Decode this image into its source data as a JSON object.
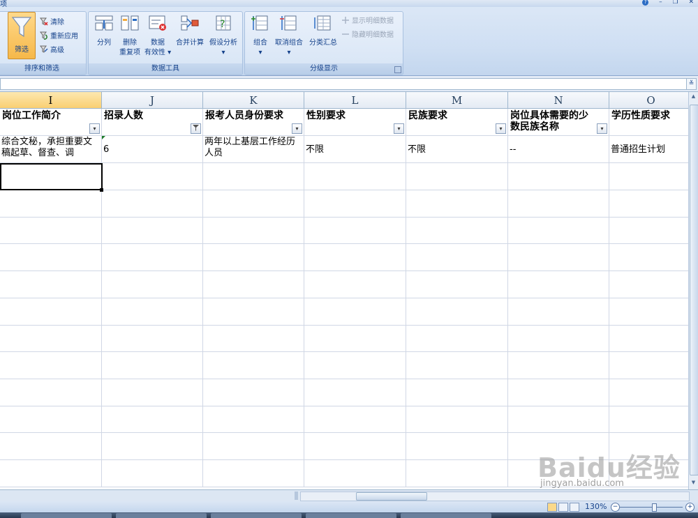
{
  "titlebar": {
    "tab_fragment": "项"
  },
  "ribbon": {
    "sort_filter": {
      "label": "排序和筛选",
      "filter": "筛选",
      "clear": "清除",
      "reapply": "重新应用",
      "advanced": "高级"
    },
    "data_tools": {
      "label": "数据工具",
      "text_to_columns": "分列",
      "remove_duplicates_1": "删除",
      "remove_duplicates_2": "重复项",
      "validation_1": "数据",
      "validation_2": "有效性",
      "consolidate": "合并计算",
      "whatif": "假设分析"
    },
    "outline": {
      "label": "分级显示",
      "group": "组合",
      "ungroup": "取消组合",
      "subtotal": "分类汇总",
      "show_detail": "显示明细数据",
      "hide_detail": "隐藏明细数据"
    }
  },
  "grid": {
    "columns": [
      "I",
      "J",
      "K",
      "L",
      "M",
      "N",
      "O"
    ],
    "active_column": "I",
    "headers": [
      "岗位工作简介",
      "招录人数",
      "报考人员身份要求",
      "性别要求",
      "民族要求",
      "岗位具体需要的少数民族名称",
      "学历性质要求"
    ],
    "row1": [
      "综合文秘，承担重要文稿起草、督查、调",
      "6",
      "两年以上基层工作经历人员",
      "不限",
      "不限",
      "--",
      "普通招生计划"
    ]
  },
  "status": {
    "zoom": "130%"
  },
  "watermark": {
    "logo": "Baidu经验",
    "url": "jingyan.baidu.com"
  }
}
